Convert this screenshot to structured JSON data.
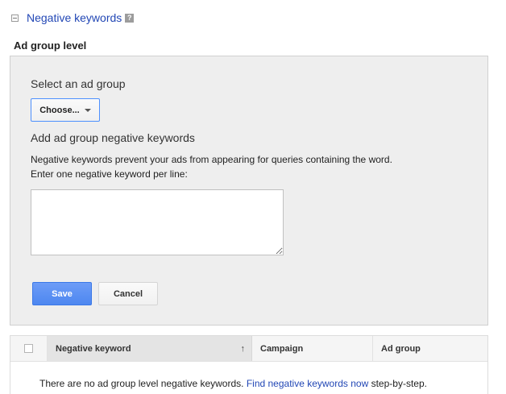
{
  "section": {
    "title": "Negative keywords",
    "help_glyph": "?",
    "level_title": "Ad group level"
  },
  "panel": {
    "select_label": "Select an ad group",
    "choose_label": "Choose...",
    "add_label": "Add ad group negative keywords",
    "description_line1": "Negative keywords prevent your ads from appearing for queries containing the word.",
    "description_line2": "Enter one negative keyword per line:",
    "textarea_value": "",
    "save_label": "Save",
    "cancel_label": "Cancel"
  },
  "table": {
    "columns": [
      "Negative keyword",
      "Campaign",
      "Ad group"
    ],
    "sort_glyph": "↑",
    "empty_text": "There are no ad group level negative keywords.",
    "empty_link": "Find negative keywords now",
    "empty_suffix": "step-by-step."
  },
  "colors": {
    "link": "#2247b5",
    "primary_button": "#4d87f0",
    "panel_background": "#eeeeee"
  },
  "icons": [
    "collapse-icon",
    "help-icon",
    "dropdown-caret-icon",
    "sort-up-icon"
  ]
}
